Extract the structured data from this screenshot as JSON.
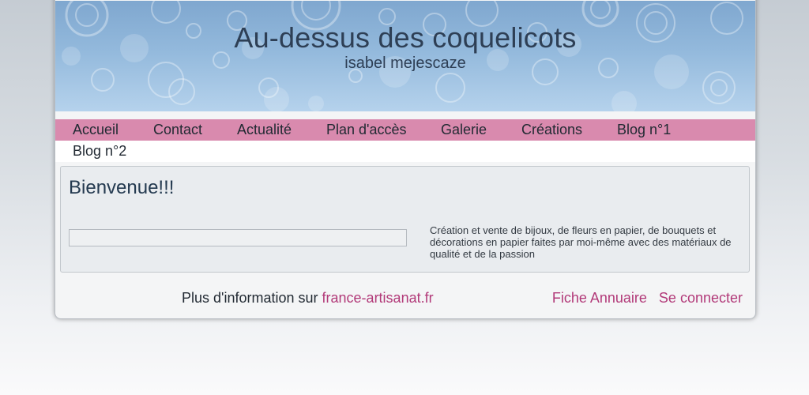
{
  "header": {
    "title": "Au-dessus des coquelicots",
    "subtitle": "isabel mejescaze"
  },
  "nav": {
    "items": [
      {
        "label": "Accueil"
      },
      {
        "label": "Contact"
      },
      {
        "label": "Actualité"
      },
      {
        "label": "Plan d'accès"
      },
      {
        "label": "Galerie"
      },
      {
        "label": "Créations"
      },
      {
        "label": "Blog n°1"
      },
      {
        "label": "Blog n°2"
      }
    ]
  },
  "content": {
    "title": "Bienvenue!!!",
    "description": "Création et vente de bijoux, de fleurs en papier, de bouquets et décorations en papier faites par moi-même avec des matériaux de qualité et de la passion"
  },
  "footer": {
    "info_prefix": "Plus d'information sur",
    "info_link": "france-artisanat.fr",
    "annuaire_link": "Fiche Annuaire",
    "login_link": "Se connecter"
  },
  "colors": {
    "nav_band": "#d98aae",
    "link": "#b23a79",
    "header_blue": "#93b9dc",
    "title_text": "#2e3f55"
  }
}
